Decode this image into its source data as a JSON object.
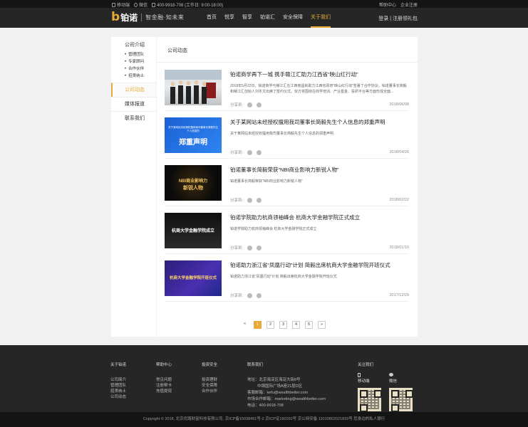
{
  "topbar": {
    "mobile": "移动端",
    "wechat": "微信",
    "phone": "400-9918-708 (工作日: 9:00-18:00)",
    "help": "帮助中心",
    "enterprise": "企业注册"
  },
  "header": {
    "logo_mark": "b",
    "logo_name": "铂诺",
    "slogan": "智金融·知未来",
    "nav": [
      "首页",
      "悦享",
      "智享",
      "铂诺汇",
      "安全保障",
      "关于我们"
    ],
    "login": "登录",
    "register": "注册领礼包"
  },
  "sidebar": {
    "group_title": "公司介绍",
    "sub_items": [
      "管理团队",
      "专家顾问",
      "合作伙伴",
      "招贤纳士"
    ],
    "items": [
      "公司动态",
      "媒体报道",
      "联系我们"
    ]
  },
  "content": {
    "title": "公司动态",
    "share_label": "分享到:",
    "news": [
      {
        "title": "铂诺商学再下一城 携手赣江汇助力江西省“映山红行动”",
        "desc": "2018年5月22日，铂诺商学与赣江汇在江西南昌就助力江西省政府“映山红行动”签署了合作协议。铂诺董事长简毅和赣江汇创始人刘冬文出席了签约仪式。双方将围绕在商学培训、产业基金、投研平台等方面形成全面...",
        "date": "2018/06/08"
      },
      {
        "title": "关于某网站未经授权擅用我司董事长简毅先生个人信息的郑重声明",
        "desc": "关于某网站未经授权擅用我司董事长简毅先生个人信息的郑重声明",
        "date": "2018/04/26"
      },
      {
        "title": "铂诺董事长简毅荣获“NBI商业影响力新锐人物”",
        "desc": "铂诺董事长简毅荣获“NBI商业影响力新锐人物”",
        "date": "2018/02/22"
      },
      {
        "title": "铂诺学院助力杭商领袖峰会 杭商大学金融学院正式成立",
        "desc": "铂诺学院助力杭商领袖峰会 杭商大学金融学院正式成立",
        "date": "2018/01/10"
      },
      {
        "title": "铂诺助力浙江省“凤凰行动”计划 简毅出席杭商大学金融学院开班仪式",
        "desc": "铂诺助力浙江省“凤凰行动”计划 简毅出席杭商大学金融学院开班仪式",
        "date": "2017/12/29"
      }
    ],
    "thumb_texts": [
      "",
      "关于某网站未经授权擅用我司董事长简毅先生个人信息的",
      "郑重声明",
      "NBI商业影响力",
      "新锐人物",
      "杭商大学金融学院成立",
      "杭商大学金融学院开班仪式"
    ],
    "pager": [
      "«",
      "1",
      "2",
      "3",
      "4",
      "5",
      "»"
    ]
  },
  "footer": {
    "col1": {
      "head": "关于铂诺",
      "links": [
        "公司简介",
        "管理团队",
        "招贤纳士",
        "公司动态"
      ]
    },
    "col2": {
      "head": "帮助中心",
      "links": [
        "常见问题",
        "注册帮卡",
        "充值提现"
      ]
    },
    "col3": {
      "head": "投资安全",
      "links": [
        "投资理财",
        "安全保障",
        "合作伙伴"
      ]
    },
    "col4": {
      "head": "联系我们",
      "lines": [
        "地址：北京海淀区海淀大街8号",
        "中钢国际广场A座21层D区",
        "客服邮箱：kefu@wealthbetter.com",
        "市场合作邮箱：marketing@wealthbetter.com",
        "电话：400-9918-708"
      ]
    },
    "follow": {
      "head": "关注我们",
      "mobile": "移动端",
      "wechat": "微信"
    }
  },
  "copyright": "Copyright © 2018, 北京优路财富科技有限公司, 京ICP备15038491号-2 京ICP证160292号 京公网安备 11010802021833号 您身边的私人银行",
  "colors": {
    "accent": "#e8a93a",
    "header": "#262626",
    "topbar": "#141414"
  }
}
